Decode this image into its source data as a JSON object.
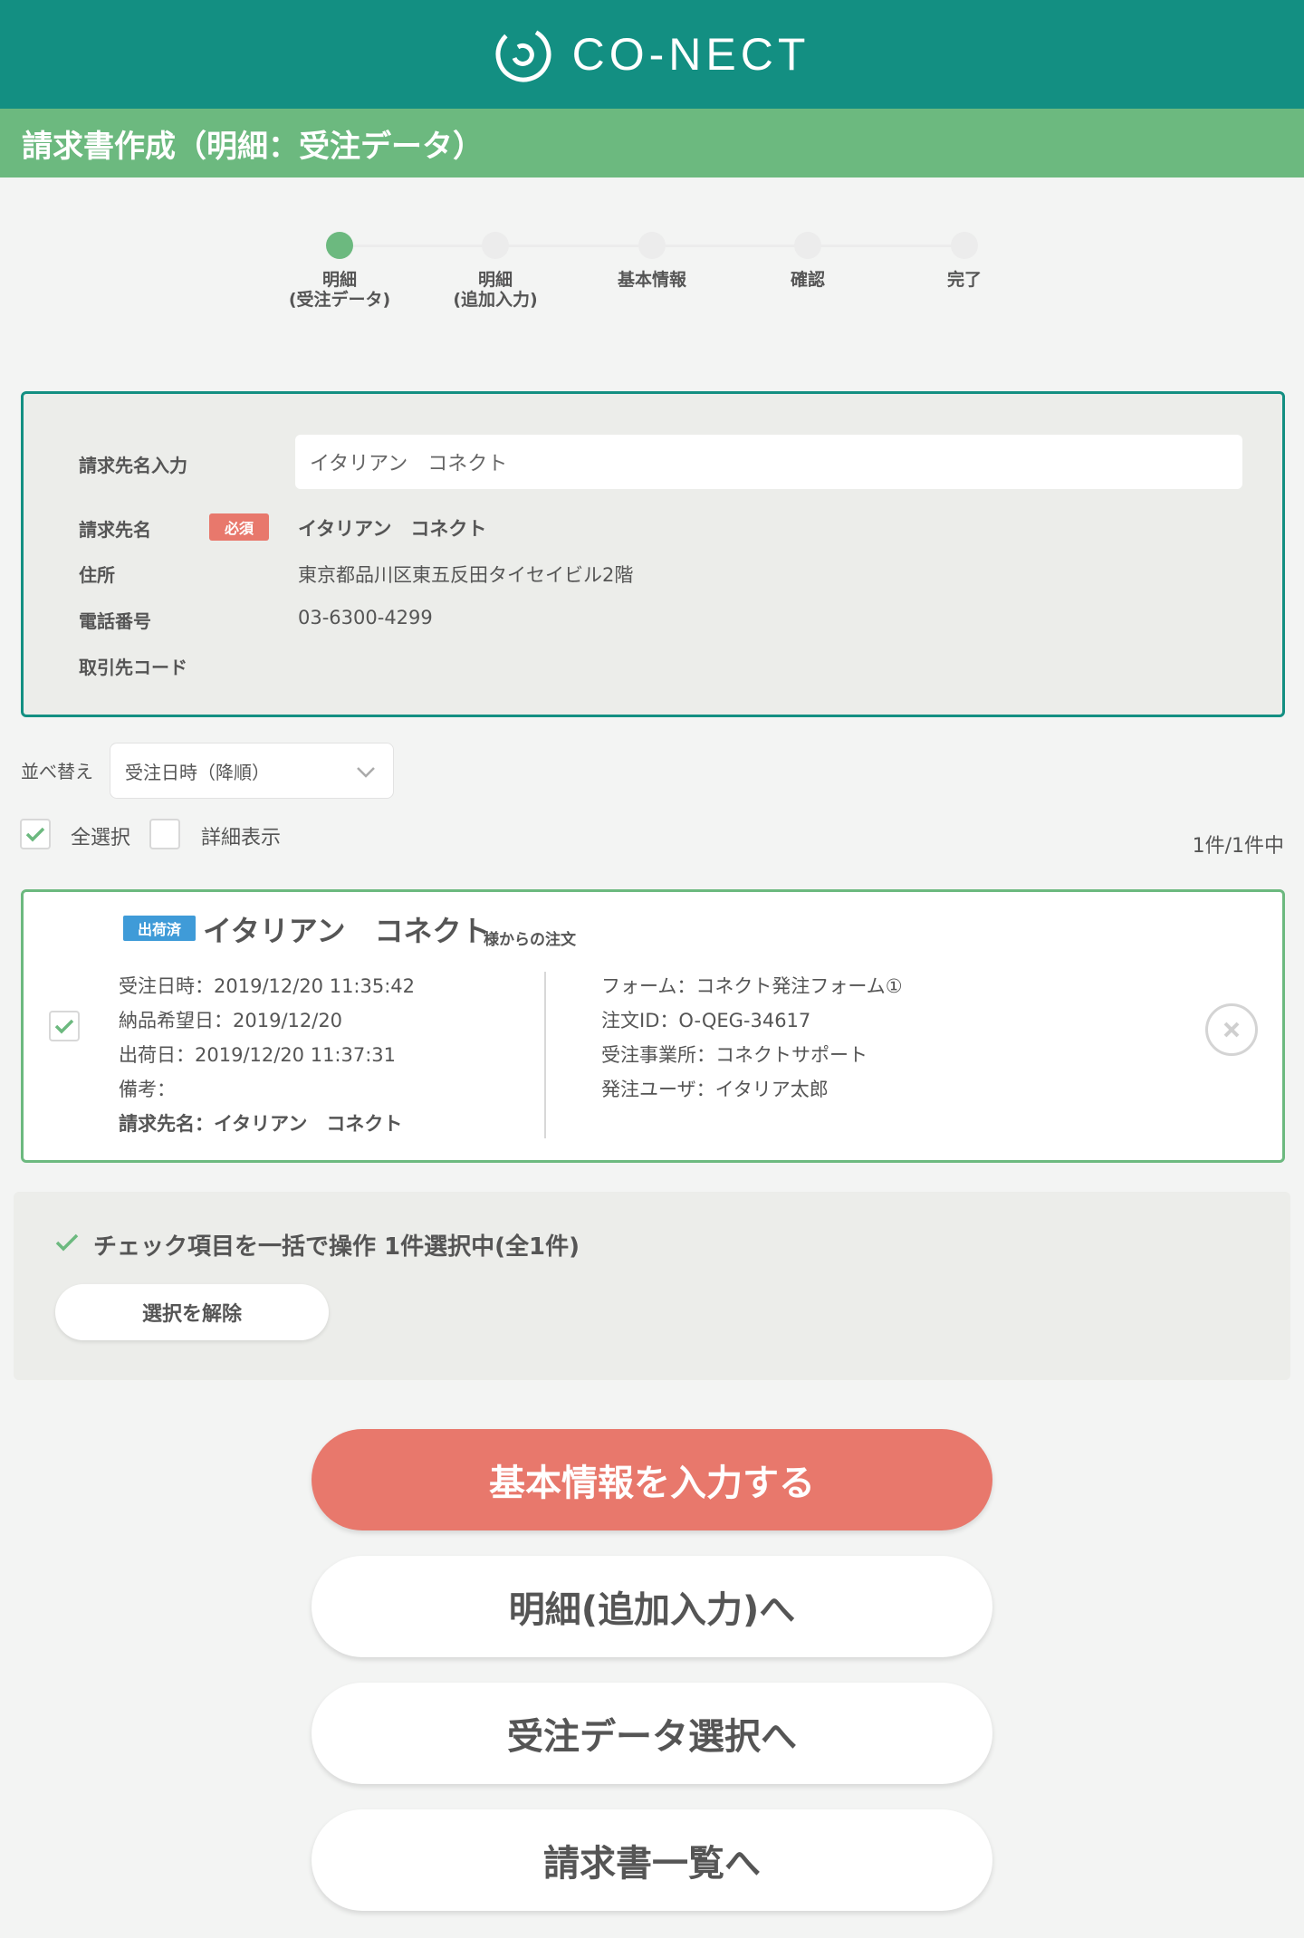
{
  "header": {
    "logo_text": "CO-NECT",
    "page_title": "請求書作成（明細：受注データ）"
  },
  "stepper": {
    "steps": [
      {
        "label": "明細\n(受注データ)",
        "active": true
      },
      {
        "label": "明細\n(追加入力)",
        "active": false
      },
      {
        "label": "基本情報",
        "active": false
      },
      {
        "label": "確認",
        "active": false
      },
      {
        "label": "完了",
        "active": false
      }
    ]
  },
  "client": {
    "input_label": "請求先名入力",
    "input_value": "イタリアン　コネクト",
    "name_label": "請求先名",
    "required_badge": "必須",
    "name_value": "イタリアン　コネクト",
    "address_label": "住所",
    "address_value": "東京都品川区東五反田タイセイビル2階",
    "phone_label": "電話番号",
    "phone_value": "03-6300-4299",
    "code_label": "取引先コード"
  },
  "list_controls": {
    "sort_label": "並べ替え",
    "sort_value": "受注日時（降順）",
    "select_all_label": "全選択",
    "detail_view_label": "詳細表示",
    "count_text": "1件/1件中"
  },
  "order": {
    "status_badge": "出荷済",
    "customer_name": "イタリアン　コネクト",
    "customer_suffix": "様からの注文",
    "order_datetime": "受注日時：2019/12/20 11:35:42",
    "delivery_date": "納品希望日：2019/12/20",
    "ship_date": "出荷日：2019/12/20 11:37:31",
    "note": "備考：",
    "billing_name": "請求先名：イタリアン　コネクト",
    "form": "フォーム：コネクト発注フォーム①",
    "order_id": "注文ID：O-QEG-34617",
    "office": "受注事業所：コネクトサポート",
    "user": "発注ユーザ：イタリア太郎"
  },
  "bulk": {
    "title": "チェック項目を一括で操作 1件選択中(全1件)",
    "clear_label": "選択を解除"
  },
  "actions": {
    "basic_info": "基本情報を入力する",
    "additional": "明細(追加入力)へ",
    "order_select": "受注データ選択へ",
    "invoice_list": "請求書一覧へ"
  },
  "colors": {
    "primary": "#138f82",
    "accent_green": "#6cb97f",
    "coral": "#e8786c",
    "badge_blue": "#3f9bd8"
  }
}
